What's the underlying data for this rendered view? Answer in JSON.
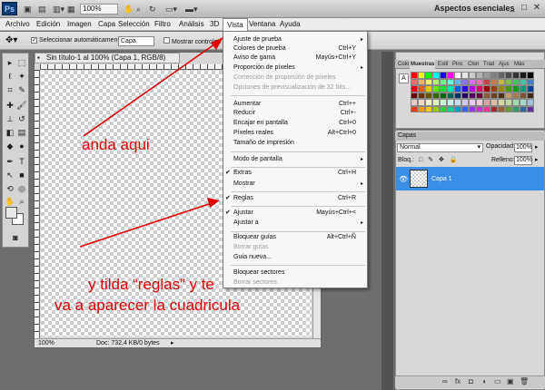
{
  "titlebar": {
    "logo": "Ps",
    "zoom": "100%",
    "workspace": "Aspectos esenciales",
    "minimize": "_",
    "maximize": "□",
    "close": "✕"
  },
  "menubar": {
    "items": [
      "Archivo",
      "Edición",
      "Imagen",
      "Capa",
      "Selección",
      "Filtro",
      "Análisis",
      "3D",
      "Vista",
      "Ventana",
      "Ayuda"
    ]
  },
  "options": {
    "auto_select_label": "Seleccionar automáticamente:",
    "auto_select_value": "Capa",
    "show_controls_label": "Mostrar controles tra"
  },
  "document": {
    "tab_title": "Sin título-1 al 100% (Capa 1, RGB/8)",
    "zoom": "100%",
    "doc_info": "Doc: 732,4 KB/0 bytes"
  },
  "vista_menu": {
    "items": [
      {
        "label": "Ajuste de prueba",
        "shortcut": "",
        "submenu": true,
        "checked": false,
        "disabled": false
      },
      {
        "label": "Colores de prueba",
        "shortcut": "Ctrl+Y",
        "submenu": false,
        "checked": false,
        "disabled": false
      },
      {
        "label": "Aviso de gama",
        "shortcut": "Mayús+Ctrl+Y",
        "submenu": false,
        "checked": false,
        "disabled": false
      },
      {
        "label": "Proporción de píxeles",
        "shortcut": "",
        "submenu": true,
        "checked": false,
        "disabled": false
      },
      {
        "label": "Corrección de proporción de píxeles",
        "shortcut": "",
        "submenu": false,
        "checked": false,
        "disabled": true
      },
      {
        "label": "Opciones de previsualización de 32 bits...",
        "shortcut": "",
        "submenu": false,
        "checked": false,
        "disabled": true
      },
      {
        "label": "Aumentar",
        "shortcut": "Ctrl++",
        "submenu": false,
        "checked": false,
        "disabled": false
      },
      {
        "label": "Reducir",
        "shortcut": "Ctrl+-",
        "submenu": false,
        "checked": false,
        "disabled": false
      },
      {
        "label": "Encajar en pantalla",
        "shortcut": "Ctrl+0",
        "submenu": false,
        "checked": false,
        "disabled": false
      },
      {
        "label": "Píxeles reales",
        "shortcut": "Alt+Ctrl+0",
        "submenu": false,
        "checked": false,
        "disabled": false
      },
      {
        "label": "Tamaño de impresión",
        "shortcut": "",
        "submenu": false,
        "checked": false,
        "disabled": false
      },
      {
        "label": "Modo de pantalla",
        "shortcut": "",
        "submenu": true,
        "checked": false,
        "disabled": false
      },
      {
        "label": "Extras",
        "shortcut": "Ctrl+H",
        "submenu": false,
        "checked": true,
        "disabled": false
      },
      {
        "label": "Mostrar",
        "shortcut": "",
        "submenu": true,
        "checked": false,
        "disabled": false
      },
      {
        "label": "Reglas",
        "shortcut": "Ctrl+R",
        "submenu": false,
        "checked": true,
        "disabled": false
      },
      {
        "label": "Ajustar",
        "shortcut": "Mayús+Ctrl+<",
        "submenu": false,
        "checked": true,
        "disabled": false
      },
      {
        "label": "Ajustar a",
        "shortcut": "",
        "submenu": true,
        "checked": false,
        "disabled": false
      },
      {
        "label": "Bloquear guías",
        "shortcut": "Alt+Ctrl+Ñ",
        "submenu": false,
        "checked": false,
        "disabled": false
      },
      {
        "label": "Borrar guías",
        "shortcut": "",
        "submenu": false,
        "checked": false,
        "disabled": true
      },
      {
        "label": "Guía nueva...",
        "shortcut": "",
        "submenu": false,
        "checked": false,
        "disabled": false
      },
      {
        "label": "Bloquear sectores",
        "shortcut": "",
        "submenu": false,
        "checked": false,
        "disabled": false
      },
      {
        "label": "Borrar sectores",
        "shortcut": "",
        "submenu": false,
        "checked": false,
        "disabled": true
      }
    ]
  },
  "color_panel": {
    "tabs": [
      "Colo",
      "Muestras",
      "Estil",
      "Pinc",
      "Clon",
      "Trad",
      "Ajus",
      "Más"
    ],
    "active_tab": "Muestras",
    "swatch_colors": [
      "#ff0000",
      "#ffff00",
      "#00ff00",
      "#00ffff",
      "#0000ff",
      "#ff00ff",
      "#ffffff",
      "#e6e6e6",
      "#cccccc",
      "#b3b3b3",
      "#999999",
      "#808080",
      "#666666",
      "#4d4d4d",
      "#333333",
      "#1a1a1a",
      "#000000",
      "#ff6e6e",
      "#ffb26e",
      "#fff36e",
      "#b2ff6e",
      "#6eff8e",
      "#6effe0",
      "#6eb2ff",
      "#8e6eff",
      "#e06eff",
      "#ff6eb2",
      "#c14545",
      "#c17f45",
      "#c1b745",
      "#7fc145",
      "#45c166",
      "#45c1a5",
      "#4580c1",
      "#e80000",
      "#e85d00",
      "#e8c900",
      "#5de800",
      "#00e82b",
      "#00e8b6",
      "#005de8",
      "#2b00e8",
      "#b600e8",
      "#e8005d",
      "#990000",
      "#994400",
      "#998800",
      "#449900",
      "#009922",
      "#009977",
      "#004499",
      "#660000",
      "#663300",
      "#665500",
      "#336600",
      "#006611",
      "#006655",
      "#003366",
      "#220066",
      "#550066",
      "#660033",
      "#8a5a3c",
      "#6b4226",
      "#4f2f17",
      "#c29a6b",
      "#a67c52",
      "#7a5535",
      "#3d2a1a",
      "#f2c9c9",
      "#f2dcc9",
      "#f2eec9",
      "#dcf2c9",
      "#c9f2d2",
      "#c9f2ea",
      "#c9dcf2",
      "#d2c9f2",
      "#eac9f2",
      "#f2c9dc",
      "#d9a3a3",
      "#d9bfa3",
      "#d9d3a3",
      "#bfd9a3",
      "#a3d9b0",
      "#a3d9cd",
      "#a3bfd9",
      "#ff3300",
      "#ff9900",
      "#ffcc00",
      "#99cc00",
      "#33cc33",
      "#00cc99",
      "#0099cc",
      "#3366ff",
      "#9933ff",
      "#cc33cc",
      "#ff3399",
      "#993333",
      "#996633",
      "#669933",
      "#339966",
      "#336699",
      "#663399"
    ]
  },
  "layers_panel": {
    "title": "Capas",
    "blend_mode": "Normal",
    "opacity_label": "Opacidad:",
    "opacity_value": "100%",
    "lock_label": "Bloq.:",
    "fill_label": "Relleno:",
    "fill_value": "100%",
    "layer_name": "Capa 1"
  },
  "annotations": {
    "text1": "anda aqui",
    "text2_line1": "y tilda “reglas” y te",
    "text2_line2": "va a aparecer la cuadricula",
    "color": "#e00000"
  },
  "colors": {
    "accent": "#3a8ee6",
    "annotation": "#e00000"
  }
}
